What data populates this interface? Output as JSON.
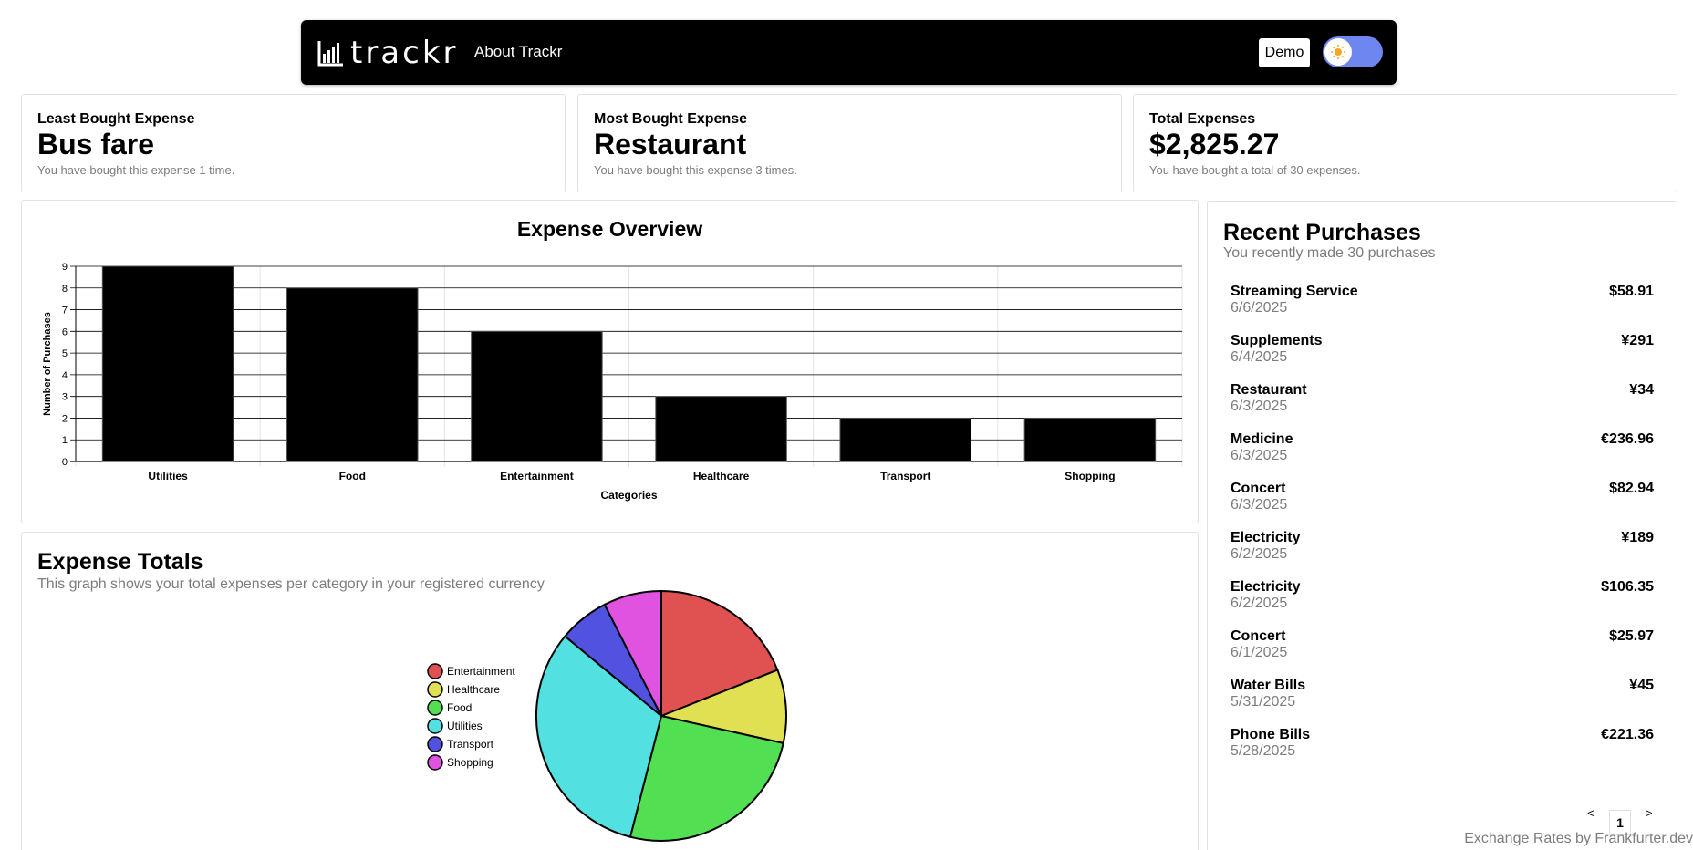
{
  "navbar": {
    "logo_text": "trackr",
    "about_link": "About Trackr",
    "demo_label": "Demo"
  },
  "stats": [
    {
      "label": "Least Bought Expense",
      "value": "Bus fare",
      "sub": "You have bought this expense 1 time."
    },
    {
      "label": "Most Bought Expense",
      "value": "Restaurant",
      "sub": "You have bought this expense 3 times."
    },
    {
      "label": "Total Expenses",
      "value": "$2,825.27",
      "sub": "You have bought a total of 30 expenses."
    }
  ],
  "overview": {
    "title": "Expense Overview"
  },
  "totals": {
    "title": "Expense Totals",
    "subtitle": "This graph shows your total expenses per category in your registered currency"
  },
  "chart_data": [
    {
      "type": "bar",
      "title": "Expense Overview",
      "xlabel": "Categories",
      "ylabel": "Number of Purchases",
      "categories": [
        "Utilities",
        "Food",
        "Entertainment",
        "Healthcare",
        "Transport",
        "Shopping"
      ],
      "values": [
        9,
        8,
        6,
        3,
        2,
        2
      ],
      "ylim": [
        0,
        9
      ],
      "yticks": [
        "0",
        "1",
        "2",
        "3",
        "4",
        "5",
        "6",
        "7",
        "8",
        "9"
      ],
      "grid": true,
      "color": "#000000"
    },
    {
      "type": "pie",
      "title": "Expense Totals",
      "legend_position": "left",
      "categories": [
        "Entertainment",
        "Healthcare",
        "Food",
        "Utilities",
        "Transport",
        "Shopping"
      ],
      "values": [
        19.0,
        9.5,
        25.5,
        32.0,
        6.5,
        7.5
      ],
      "colors": [
        "#e05252",
        "#e0e052",
        "#52e052",
        "#52e0e0",
        "#5252e0",
        "#e052e0"
      ]
    }
  ],
  "recent": {
    "title": "Recent Purchases",
    "subtitle": "You recently made 30 purchases",
    "items": [
      {
        "name": "Streaming Service",
        "date": "6/6/2025",
        "amount": "$58.91"
      },
      {
        "name": "Supplements",
        "date": "6/4/2025",
        "amount": "¥291"
      },
      {
        "name": "Restaurant",
        "date": "6/3/2025",
        "amount": "¥34"
      },
      {
        "name": "Medicine",
        "date": "6/3/2025",
        "amount": "€236.96"
      },
      {
        "name": "Concert",
        "date": "6/3/2025",
        "amount": "$82.94"
      },
      {
        "name": "Electricity",
        "date": "6/2/2025",
        "amount": "¥189"
      },
      {
        "name": "Electricity",
        "date": "6/2/2025",
        "amount": "$106.35"
      },
      {
        "name": "Concert",
        "date": "6/1/2025",
        "amount": "$25.97"
      },
      {
        "name": "Water Bills",
        "date": "5/31/2025",
        "amount": "¥45"
      },
      {
        "name": "Phone Bills",
        "date": "5/28/2025",
        "amount": "€221.36"
      }
    ],
    "pagination": {
      "prev": "<",
      "current": "1",
      "next": ">"
    }
  },
  "footer": {
    "text": "Exchange Rates by Frankfurter.dev"
  }
}
